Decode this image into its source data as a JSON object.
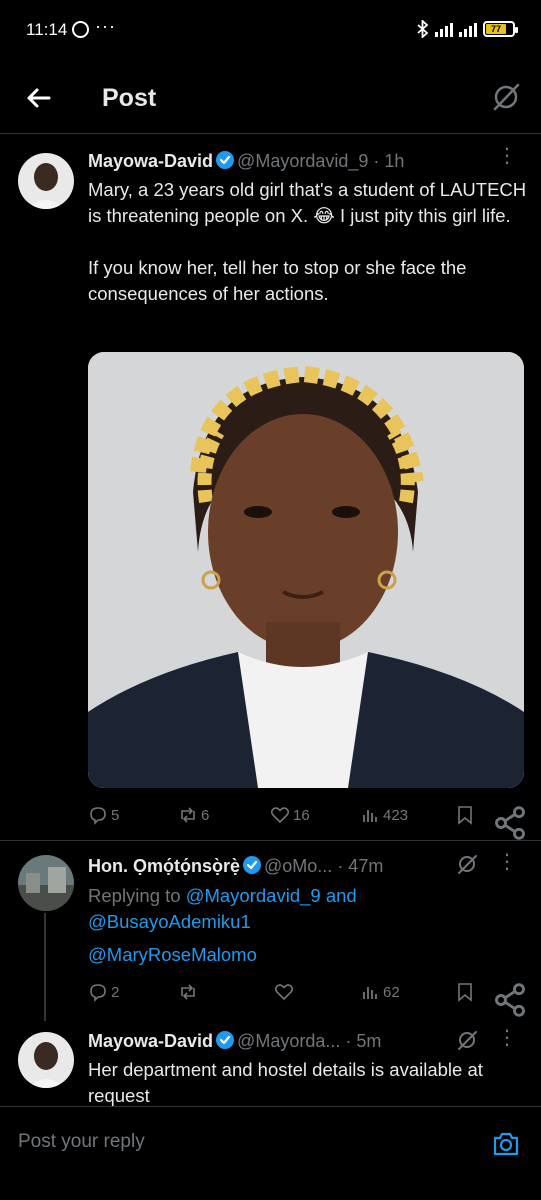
{
  "status_bar": {
    "time": "11:14",
    "dots": "···",
    "battery": "77"
  },
  "header": {
    "title": "Post"
  },
  "main_tweet": {
    "name": "Mayowa-David",
    "handle": "@Mayordavid_9",
    "time": "· 1h",
    "text": "Mary, a 23 years old girl that's a student of LAUTECH is threatening people on X. 😂 I just pity this girl life.\n\nIf you know her, tell her to stop or she face the consequences of her actions.",
    "stats": {
      "replies": "5",
      "reposts": "6",
      "likes": "16",
      "views": "423"
    }
  },
  "reply1": {
    "name": "Hon. Ọmọ́tọ́nsọ̀rẹ̀",
    "handle": "@oMo...",
    "time": "· 47m",
    "replying_prefix": "Replying to ",
    "replying_user1": "@Mayordavid_9",
    "replying_and": " and",
    "replying_user2": "@BusayoAdemiku1",
    "mention": "@MaryRoseMalomo",
    "stats": {
      "replies": "2",
      "views": "62"
    }
  },
  "reply2": {
    "name": "Mayowa-David",
    "handle": "@Mayorda...",
    "time": "· 5m",
    "text": "Her department and hostel details is available at request"
  },
  "reply_bar": {
    "placeholder": "Post your reply"
  },
  "colors": {
    "accent": "#1d9bf0",
    "background": "#000000",
    "text": "#e7e9ea",
    "muted": "#71767b"
  }
}
